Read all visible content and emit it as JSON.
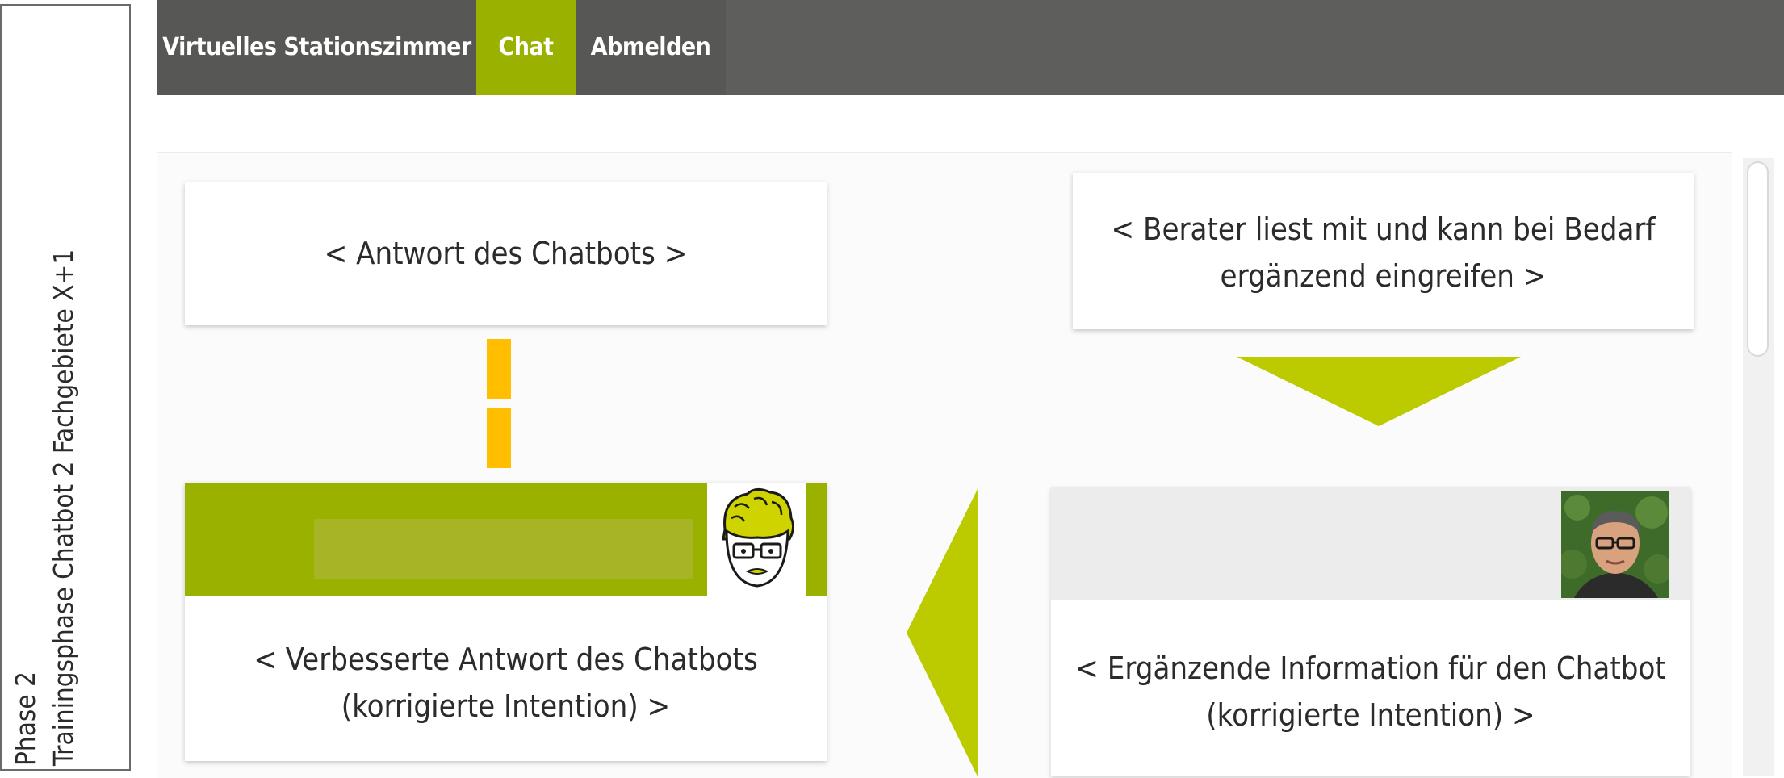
{
  "side_label": {
    "line1": "Phase 2",
    "line2": "Trainingsphase Chatbot 2  Fachgebiete X+1"
  },
  "nav": {
    "items": [
      {
        "label": "Virtuelles Stationszimmer"
      },
      {
        "label": "Chat",
        "active": true
      },
      {
        "label": "Abmelden"
      }
    ],
    "colors": {
      "bar": "#575756",
      "active": "#9ab100"
    }
  },
  "cards": {
    "chatbot_answer": "< Antwort des Chatbots >",
    "advisor_line1": "< Berater liest mit und kann bei Bedarf",
    "advisor_line2": "ergänzend eingreifen >",
    "improved_line1": "< Verbesserte Antwort des Chatbots",
    "improved_line2": "(korrigierte Intention) >",
    "supplement_line1": "< Ergänzende Information für den Chatbot",
    "supplement_line2": "(korrigierte Intention) >"
  },
  "colors": {
    "accent_green": "#9ab100",
    "arrow_green": "#bccb00",
    "connector_yellow": "#ffbf00"
  }
}
